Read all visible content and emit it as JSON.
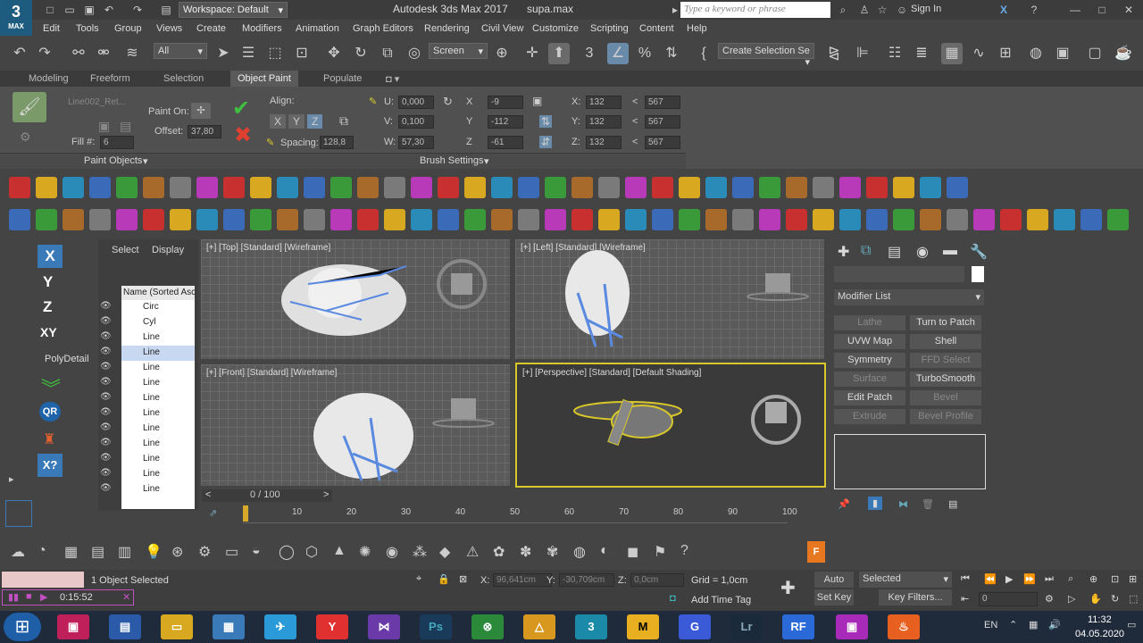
{
  "title_bar": {
    "workspace": "Workspace: Default",
    "app_title": "Autodesk 3ds Max 2017",
    "file_name": "supa.max",
    "search_placeholder": "Type a keyword or phrase",
    "sign_in": "Sign In"
  },
  "logo": {
    "big": "3",
    "small": "MAX"
  },
  "menu": [
    "Edit",
    "Tools",
    "Group",
    "Views",
    "Create",
    "Modifiers",
    "Animation",
    "Graph Editors",
    "Rendering",
    "Civil View",
    "Customize",
    "Scripting",
    "Content",
    "Help"
  ],
  "toolbar": {
    "filter": "All",
    "coord": "Screen",
    "selection_set": "Create Selection Se"
  },
  "ribbon_tabs": [
    "Modeling",
    "Freeform",
    "Selection",
    "Object Paint",
    "Populate"
  ],
  "ribbon": {
    "object_name": "Line002_Ret...",
    "paint_on": "Paint On:",
    "offset_label": "Offset:",
    "offset_value": "37,80",
    "fill_label": "Fill #:",
    "fill_value": "6",
    "align_label": "Align:",
    "spacing_label": "Spacing:",
    "spacing_value": "128,8",
    "u_label": "U:",
    "u_value": "0,000",
    "v_label": "V:",
    "v_value": "0,100",
    "w_label": "W:",
    "w_value": "57,30",
    "x_label": "X",
    "x_value": "-9",
    "y_label": "Y",
    "y_value": "-112",
    "z_label": "Z",
    "z_value": "-61",
    "sx_value": "132",
    "sy_value": "132",
    "sz_value": "132",
    "ex_value": "567",
    "ey_value": "567",
    "ez_value": "567",
    "paint_objects": "Paint Objects",
    "brush_settings": "Brush Settings"
  },
  "axis_panel": {
    "x": "X",
    "y": "Y",
    "z": "Z",
    "xy": "XY",
    "poly": "PolyDetail"
  },
  "scene_explorer": {
    "tabs": [
      "Select",
      "Display"
    ],
    "header": "Name (Sorted Asc",
    "rows": [
      "Circ",
      "Cyl",
      "Line",
      "Line",
      "Line",
      "Line",
      "Line",
      "Line",
      "Line",
      "Line",
      "Line",
      "Line",
      "Line"
    ]
  },
  "viewports": {
    "top": "[+] [Top] [Standard] [Wireframe]",
    "left": "[+] [Left] [Standard] [Wireframe]",
    "front": "[+] [Front] [Standard] [Wireframe]",
    "persp": "[+] [Perspective] [Standard] [Default Shading]"
  },
  "command_panel": {
    "modifier_list": "Modifier List",
    "buttons": [
      {
        "label": "Lathe",
        "dim": true
      },
      {
        "label": "Turn to Patch",
        "dim": false
      },
      {
        "label": "UVW Map",
        "dim": false
      },
      {
        "label": "Shell",
        "dim": false
      },
      {
        "label": "Symmetry",
        "dim": false
      },
      {
        "label": "FFD Select",
        "dim": true
      },
      {
        "label": "Surface",
        "dim": true
      },
      {
        "label": "TurboSmooth",
        "dim": false
      },
      {
        "label": "Edit Patch",
        "dim": false
      },
      {
        "label": "Bevel",
        "dim": true
      },
      {
        "label": "Extrude",
        "dim": true
      },
      {
        "label": "Bevel Profile",
        "dim": true
      }
    ]
  },
  "timeline": {
    "frame": "0 / 100",
    "ticks": [
      "10",
      "20",
      "30",
      "40",
      "50",
      "60",
      "70",
      "80",
      "90",
      "100"
    ],
    "progress": 0
  },
  "status": {
    "selected": "1 Object Selected",
    "time": "0:15:52",
    "x_label": "X:",
    "x_value": "96,641cm",
    "y_label": "Y:",
    "y_value": "-30,709cm",
    "z_label": "Z:",
    "z_value": "0,0cm",
    "grid": "Grid = 1,0cm",
    "add_time_tag": "Add Time Tag",
    "auto_key": "Auto Key",
    "set_key": "Set Key",
    "selected_dd": "Selected",
    "key_filters": "Key Filters...",
    "frame_value": "0"
  },
  "taskbar": {
    "lang": "EN",
    "clock": "11:32",
    "date": "04.05.2020"
  },
  "colors": {
    "accent_blue": "#3a9fd8",
    "select_yellow": "#d8c82a",
    "red_x": "#e04030",
    "green_check": "#3fbf3f"
  }
}
